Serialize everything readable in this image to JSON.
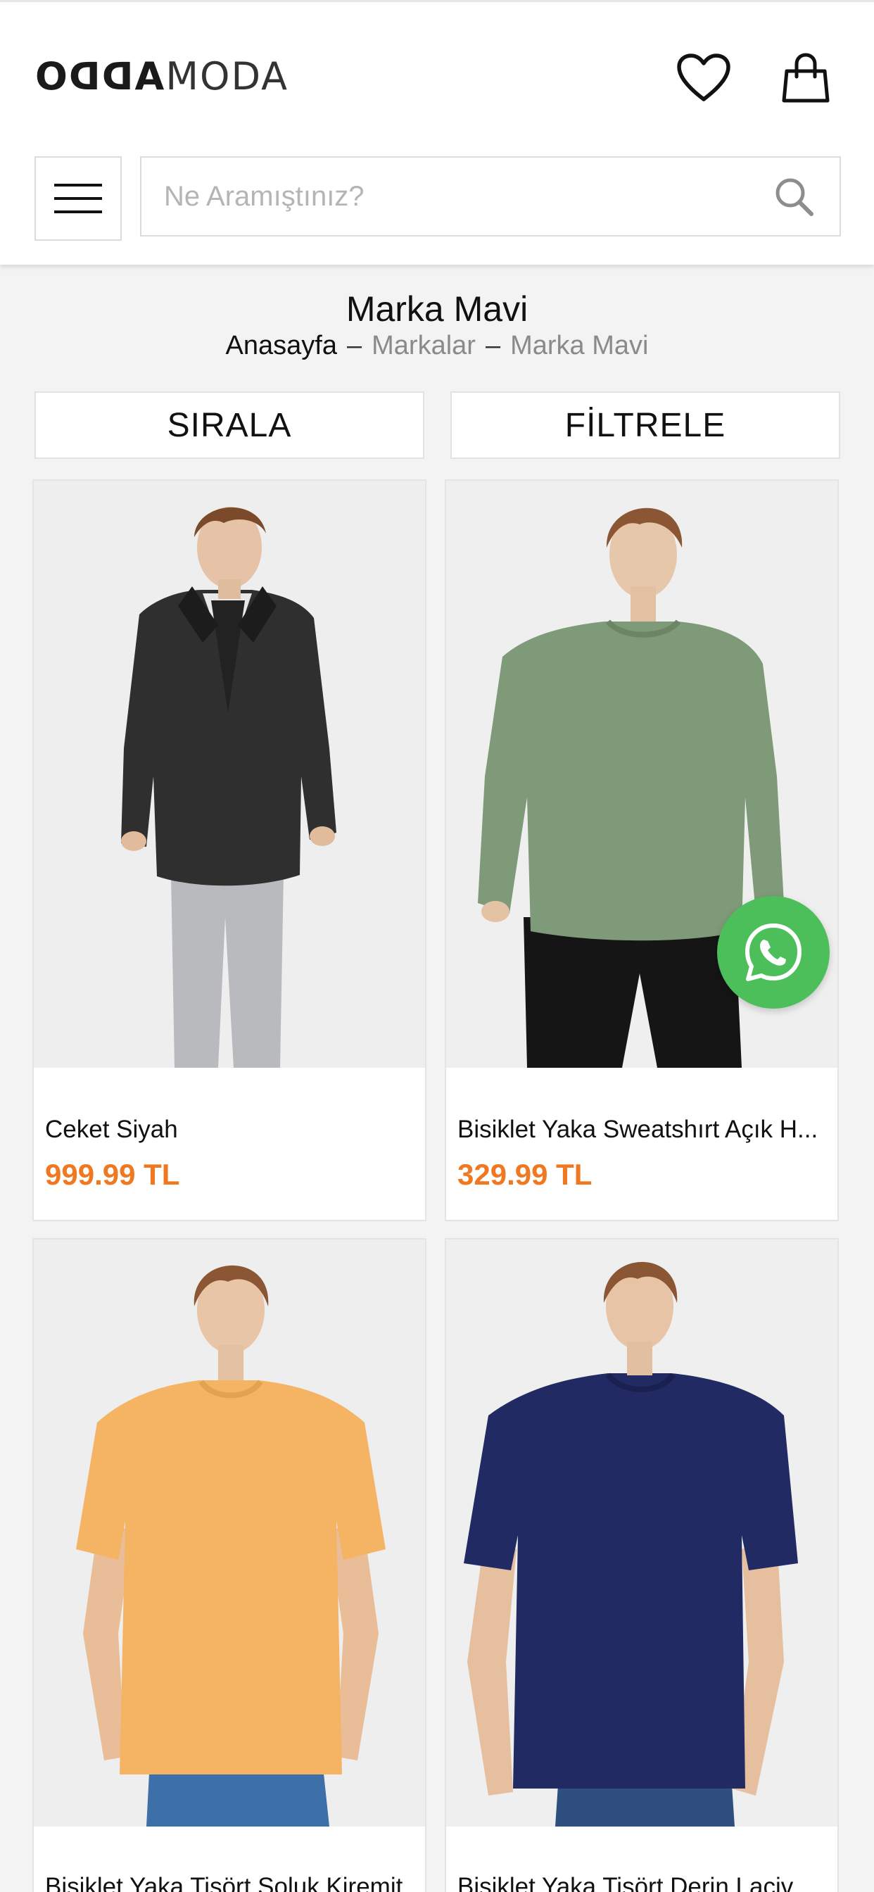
{
  "header": {
    "logo_bold": "OᗡᗡA",
    "logo_light": "MODA",
    "search_placeholder": "Ne Aramıştınız?"
  },
  "page": {
    "title": "Marka Mavi",
    "breadcrumb": [
      "Anasayfa",
      "Markalar",
      "Marka Mavi"
    ],
    "breadcrumb_separator": "–"
  },
  "actions": {
    "sort_label": "SIRALA",
    "filter_label": "FİLTRELE"
  },
  "products": [
    {
      "name": "Ceket Siyah",
      "price": "999.99 TL",
      "garment_color": "#2b2b2b"
    },
    {
      "name": "Bisiklet Yaka Sweatshırt Açık H...",
      "price": "329.99 TL",
      "garment_color": "#7f9a78"
    },
    {
      "name": "Bisiklet Yaka Tişört Soluk Kiremit",
      "price": "",
      "garment_color": "#f4b464"
    },
    {
      "name": "Bisiklet Yaka Tişört Derin Laciv",
      "price": "",
      "garment_color": "#222a63"
    }
  ],
  "colors": {
    "price": "#f07820",
    "whatsapp": "#4cbf5b",
    "background": "#f3f3f3"
  },
  "icons": [
    "heart-icon",
    "shopping-bag-icon",
    "hamburger-menu-icon",
    "search-icon",
    "whatsapp-icon"
  ]
}
